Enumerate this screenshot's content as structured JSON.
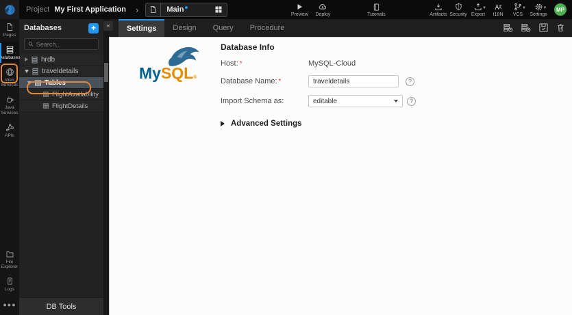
{
  "topbar": {
    "project_label": "Project",
    "project_name": "My First Application",
    "page_selector": {
      "page_name": "Main"
    },
    "actions": {
      "preview": "Preview",
      "deploy": "Deploy",
      "tutorials": "Tutorials"
    },
    "utilities": {
      "artifacts": "Artifacts",
      "security": "Security",
      "export": "Export",
      "i18n": "I18N",
      "vcs": "VCS",
      "settings": "Settings"
    },
    "avatar_initials": "MP"
  },
  "left_rail": {
    "items": [
      {
        "label": "Pages"
      },
      {
        "label": "Databases"
      },
      {
        "label": "Web Services"
      },
      {
        "label": "Java Services"
      },
      {
        "label": "APIs"
      }
    ],
    "bottom_items": [
      {
        "label": "File Explorer"
      },
      {
        "label": "Logs"
      }
    ]
  },
  "db_panel": {
    "title": "Databases",
    "search_placeholder": "Search...",
    "tree": {
      "hrdb": "hrdb",
      "traveldetails": "traveldetails",
      "tables_group": "Tables",
      "tables": [
        "FlightAvailability",
        "FlightDetails"
      ]
    },
    "footer_button": "DB Tools"
  },
  "workspace": {
    "tabs": [
      {
        "label": "Settings",
        "active": true
      },
      {
        "label": "Design",
        "active": false
      },
      {
        "label": "Query",
        "active": false
      },
      {
        "label": "Procedure",
        "active": false
      }
    ],
    "form": {
      "heading": "Database Info",
      "host_label": "Host:",
      "host_value": "MySQL-Cloud",
      "dbname_label": "Database Name:",
      "dbname_value": "traveldetails",
      "schema_label": "Import Schema as:",
      "schema_value": "editable",
      "required_marker": "*",
      "help_glyph": "?",
      "advanced_label": "Advanced Settings"
    },
    "logo": {
      "brand_part1": "My",
      "brand_part2": "SQL",
      "registered": "®"
    }
  },
  "colors": {
    "accent_blue": "#2196f3",
    "annotation_orange": "#e2873b",
    "mysql_blue": "#00618a",
    "mysql_orange": "#e48e00",
    "avatar_green": "#4caf50",
    "selected_row": "#49525a"
  }
}
